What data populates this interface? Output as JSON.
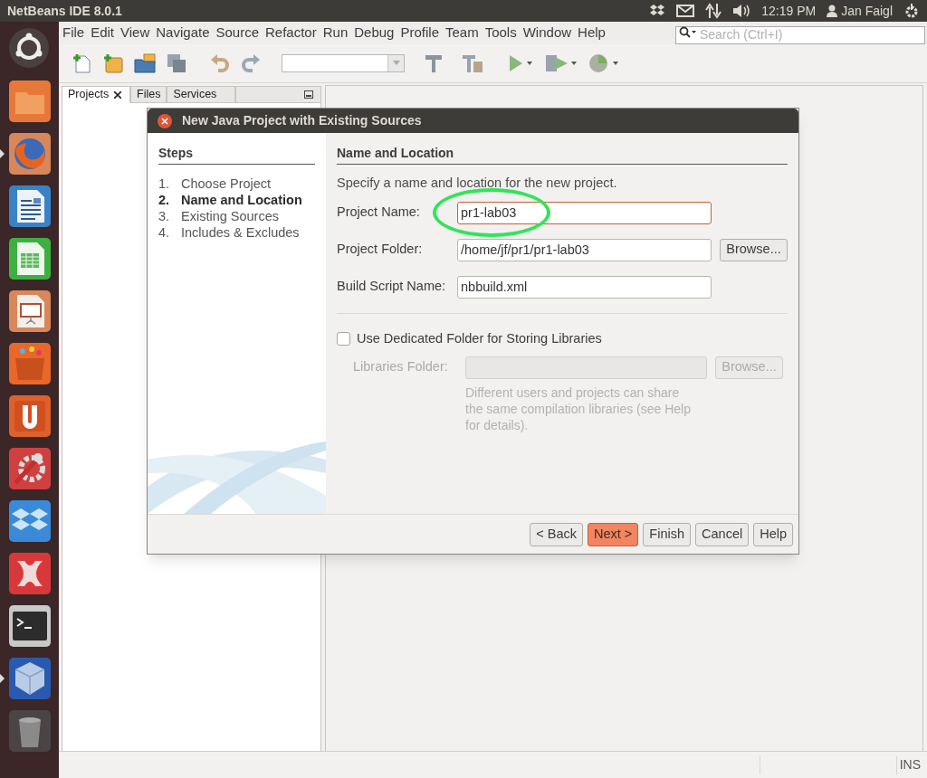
{
  "top_panel": {
    "title": "NetBeans IDE 8.0.1",
    "clock": "12:19 PM",
    "user": "Jan Faigl"
  },
  "launcher": [
    {
      "kind": "dash",
      "running": false
    },
    {
      "kind": "files",
      "running": false
    },
    {
      "kind": "firefox",
      "running": true
    },
    {
      "kind": "writer",
      "running": false
    },
    {
      "kind": "calc",
      "running": false
    },
    {
      "kind": "impress",
      "running": false
    },
    {
      "kind": "store",
      "running": false
    },
    {
      "kind": "ubuntuone",
      "running": false
    },
    {
      "kind": "settings",
      "running": false
    },
    {
      "kind": "dropbox",
      "running": false
    },
    {
      "kind": "crossover",
      "running": false
    },
    {
      "kind": "terminal",
      "running": false
    },
    {
      "kind": "virtualbox",
      "running": true
    },
    {
      "kind": "trash",
      "running": false
    }
  ],
  "menu": [
    "File",
    "Edit",
    "View",
    "Navigate",
    "Source",
    "Refactor",
    "Run",
    "Debug",
    "Profile",
    "Team",
    "Tools",
    "Window",
    "Help"
  ],
  "search": {
    "placeholder": "Search (Ctrl+I)"
  },
  "panel_tabs": [
    {
      "label": "Projects",
      "selected": true,
      "closable": true
    },
    {
      "label": "Files",
      "selected": false,
      "closable": false
    },
    {
      "label": "Services",
      "selected": false,
      "closable": false
    }
  ],
  "dialog": {
    "title": "New Java Project with Existing Sources",
    "steps_heading": "Steps",
    "steps": [
      {
        "number": "1.",
        "label": "Choose Project",
        "selected": false
      },
      {
        "number": "2.",
        "label": "Name and Location",
        "selected": true
      },
      {
        "number": "3.",
        "label": "Existing Sources",
        "selected": false
      },
      {
        "number": "4.",
        "label": "Includes & Excludes",
        "selected": false
      }
    ],
    "section_heading": "Name and Location",
    "intro": "Specify a name and location for the new project.",
    "fields": [
      {
        "label": "Project Name:",
        "value": "pr1-lab03",
        "focused": true,
        "circled": true
      },
      {
        "label": "Project Folder:",
        "value": "/home/jf/pr1/pr1-lab03",
        "focused": false,
        "circled": false,
        "button": "Browse..."
      },
      {
        "label": "Build Script Name:",
        "value": "nbbuild.xml",
        "focused": false,
        "circled": false
      }
    ],
    "checkbox": {
      "label": "Use Dedicated Folder for Storing Libraries",
      "checked": false
    },
    "libraries": {
      "label": "Libraries Folder:",
      "button": "Browse...",
      "disabled": true,
      "note": "Different users and projects can share the same compilation libraries (see Help for details)."
    },
    "buttons": [
      {
        "label": "< Back",
        "default": false
      },
      {
        "label": "Next >",
        "default": true
      },
      {
        "label": "Finish",
        "default": false
      },
      {
        "label": "Cancel",
        "default": false
      },
      {
        "label": "Help",
        "default": false
      }
    ]
  },
  "status_bar": {
    "mode": "INS"
  }
}
